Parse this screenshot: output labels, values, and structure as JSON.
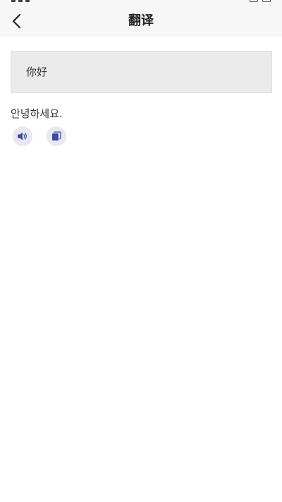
{
  "header": {
    "title": "翻译",
    "back_icon": "chevron-left-icon"
  },
  "source": {
    "text": "你好"
  },
  "result": {
    "text": "안녕하세요."
  },
  "actions": {
    "speak_icon": "speaker-icon",
    "copy_icon": "copy-icon"
  },
  "colors": {
    "accent": "#3e4a99",
    "header_bg": "#f7f7f7",
    "source_bg": "#ebebeb",
    "icon_bg": "#e8e8f3"
  }
}
